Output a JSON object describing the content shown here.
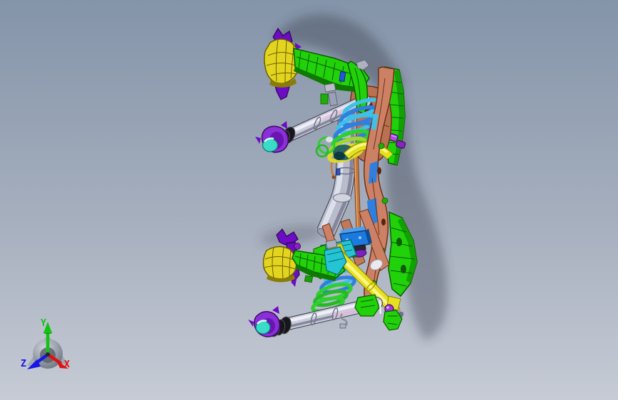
{
  "viewport": {
    "kind": "cad-3d-model-view",
    "model_name": "rear-suspension-axle-assembly",
    "background_top": "#8494a9",
    "background_bottom": "#c6cbd5",
    "shadow_color": "#3f4654"
  },
  "axis_triad": {
    "x_label": "X",
    "y_label": "Y",
    "z_label": "Z",
    "x_color": "#e01010",
    "y_color": "#12c312",
    "z_color": "#1515e8"
  },
  "palette": {
    "bg_top": "#8494a9",
    "bg_mid": "#a6afbe",
    "bg_bottom": "#c6cbd5",
    "shadow": "#3f4654",
    "green": "#21d10a",
    "green_dark": "#0b5c00",
    "green_side": "#12a004",
    "green_under": "#0e7a02",
    "yellow": "#e3d51f",
    "yellow_dark": "#6d6000",
    "yellow_lip": "#8a7c08",
    "purple": "#6c0cc4",
    "purple_dark": "#2e064e",
    "violet": "#8b2fd6",
    "violet_in": "#6a14b2",
    "cyan": "#39dcc9",
    "cyan_dark": "#0e7a74",
    "silver": "#c9cbd9",
    "silver_hi": "#eef0f8",
    "silver_lo": "#85889c",
    "silver_out": "#3c3c48",
    "tube": "#b9bccb",
    "tube_hi": "#e0e3ef",
    "tube_lo": "#84879b",
    "pink": "#e7c0e0",
    "copper": "#c87840",
    "copper_dark": "#7a4018",
    "salmon": "#cd8164",
    "salmon_dark": "#6b3118",
    "knuckle": "#b97152",
    "knuckle_hole": "#5a2410",
    "sp_blue": "#2f7fe0",
    "sp_cyan": "#3fc0e8",
    "sp_green": "#2fcf2f",
    "sp_green2": "#27b827",
    "sp_lime": "#9fd828",
    "sp_yellow": "#ddd82a",
    "blue_brk": "#1b7ae0",
    "blue_brk_top": "#4aa0f0",
    "blue_brk_side": "#0e4e96",
    "teal": "#24c4d4",
    "teal_dark": "#0a6a74",
    "strut": "#e8e11f",
    "strut_hi": "#f9f689",
    "strut_out": "#8a8408",
    "boot": "#17171b",
    "ax_x": "#e01010",
    "ax_y": "#12c312",
    "ax_z": "#1515e8"
  },
  "parts": [
    {
      "name": "trailing-arm-upper",
      "color": "#21d10a"
    },
    {
      "name": "trailing-arm-lower",
      "color": "#21d10a"
    },
    {
      "name": "bushing-cup-upper",
      "color": "#e3d51f"
    },
    {
      "name": "bushing-cup-lower",
      "color": "#e3d51f"
    },
    {
      "name": "bushing-bracket-upper",
      "color": "#6c0cc4"
    },
    {
      "name": "bushing-bracket-lower",
      "color": "#6c0cc4"
    },
    {
      "name": "driveshaft-upper",
      "color": "#c9cbd9"
    },
    {
      "name": "driveshaft-lower",
      "color": "#c9cbd9"
    },
    {
      "name": "cv-boot-upper",
      "color": "#17171b"
    },
    {
      "name": "cv-boot-lower",
      "color": "#17171b"
    },
    {
      "name": "cv-housing-upper",
      "color": "#8b2fd6"
    },
    {
      "name": "cv-housing-lower",
      "color": "#8b2fd6"
    },
    {
      "name": "cv-cap-upper",
      "color": "#39dcc9"
    },
    {
      "name": "cv-cap-lower",
      "color": "#39dcc9"
    },
    {
      "name": "coil-spring-upper",
      "color": "#3fc0e8"
    },
    {
      "name": "coil-spring-lower",
      "color": "#2fcf2f"
    },
    {
      "name": "stabilizer-bar",
      "color": "#e6df1d"
    },
    {
      "name": "shock-strut",
      "color": "#e8e11f"
    },
    {
      "name": "subframe-rail",
      "color": "#cd8164"
    },
    {
      "name": "knuckle-bracket",
      "color": "#b97152"
    },
    {
      "name": "frame-channel",
      "color": "#21d10a"
    },
    {
      "name": "crossmember-tube",
      "color": "#b9bccb"
    },
    {
      "name": "brake-line-rod",
      "color": "#c87840"
    },
    {
      "name": "mount-bracket-blue",
      "color": "#1b7ae0"
    },
    {
      "name": "mount-plate-teal",
      "color": "#24c4d4"
    },
    {
      "name": "bump-stop-knobs",
      "color": "#a33ad8"
    }
  ]
}
